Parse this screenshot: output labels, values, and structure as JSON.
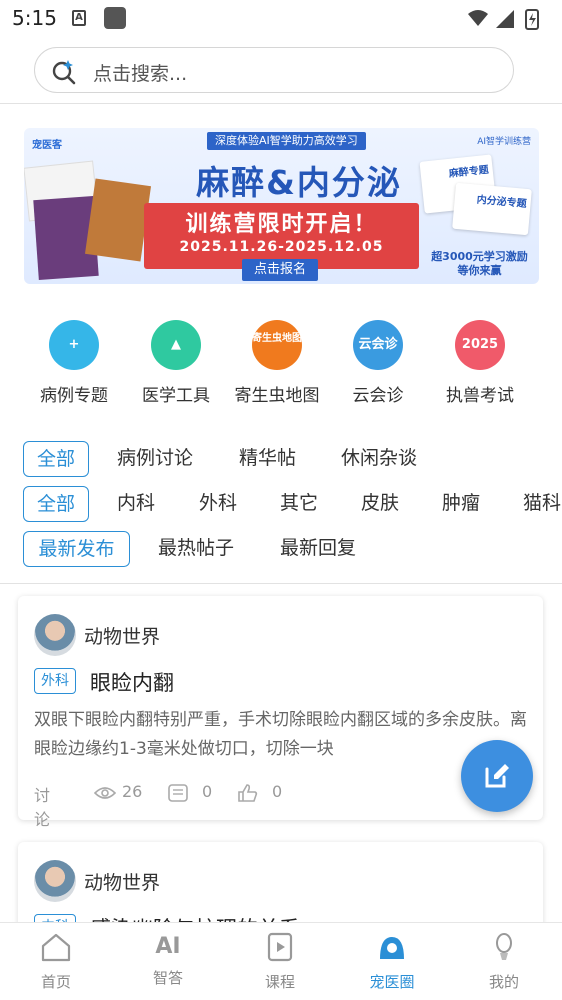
{
  "status_bar": {
    "time": "5:15",
    "a_icon": "A"
  },
  "search": {
    "placeholder": "点击搜索..."
  },
  "banner": {
    "logo": "宠医客",
    "top_text": "深度体验AI智学助力高效学习",
    "corner_text": "AI智学训练营",
    "title": "麻醉&内分泌",
    "subtitle": "训练营限时开启！",
    "dates": "2025.11.26-2025.12.05",
    "signup": "点击报名",
    "card1": "麻醉专题",
    "card2": "内分泌专题",
    "reward_line1": "超3000元学习激励",
    "reward_line2": "等你来赢"
  },
  "shortcuts": [
    {
      "label": "病例专题",
      "icon": "case-folder-icon",
      "color": "#35b6e8",
      "glyph": "+"
    },
    {
      "label": "医学工具",
      "icon": "medicine-bottle-icon",
      "color": "#2fc9a0",
      "glyph": "▲"
    },
    {
      "label": "寄生虫地图",
      "icon": "parasite-map-icon",
      "color": "#f07a1e",
      "glyph": "寄生虫地图"
    },
    {
      "label": "云会诊",
      "icon": "cloud-consult-icon",
      "color": "#3a9be0",
      "glyph": "云会诊"
    },
    {
      "label": "执兽考试",
      "icon": "exam-icon",
      "color": "#f05a6a",
      "glyph": "2025"
    }
  ],
  "filters": {
    "category": [
      "全部",
      "病例讨论",
      "精华帖",
      "休闲杂谈"
    ],
    "department": [
      "全部",
      "内科",
      "外科",
      "其它",
      "皮肤",
      "肿瘤",
      "猫科"
    ],
    "sort": [
      "最新发布",
      "最热帖子",
      "最新回复"
    ]
  },
  "posts": [
    {
      "author": "动物世界",
      "tag": "外科",
      "title": "眼睑内翻",
      "body": "双眼下眼睑内翻特别严重，手术切除眼睑内翻区域的多余皮肤。离眼睑边缘约1-3毫米处做切口，切除一块",
      "type": "讨论",
      "views": "26",
      "comments": "0",
      "likes": "0"
    },
    {
      "author": "动物世界",
      "tag": "内科",
      "title": "感染幽除与护理的关系"
    }
  ],
  "nav": [
    {
      "label": "首页",
      "icon": "home-icon"
    },
    {
      "label": "智答",
      "icon": "ai-icon",
      "glyph": "AI"
    },
    {
      "label": "课程",
      "icon": "course-play-icon"
    },
    {
      "label": "宠医圈",
      "icon": "pet-circle-icon"
    },
    {
      "label": "我的",
      "icon": "profile-icon"
    }
  ],
  "colors": {
    "accent": "#2b8fd6",
    "fab": "#3d8fe0"
  }
}
